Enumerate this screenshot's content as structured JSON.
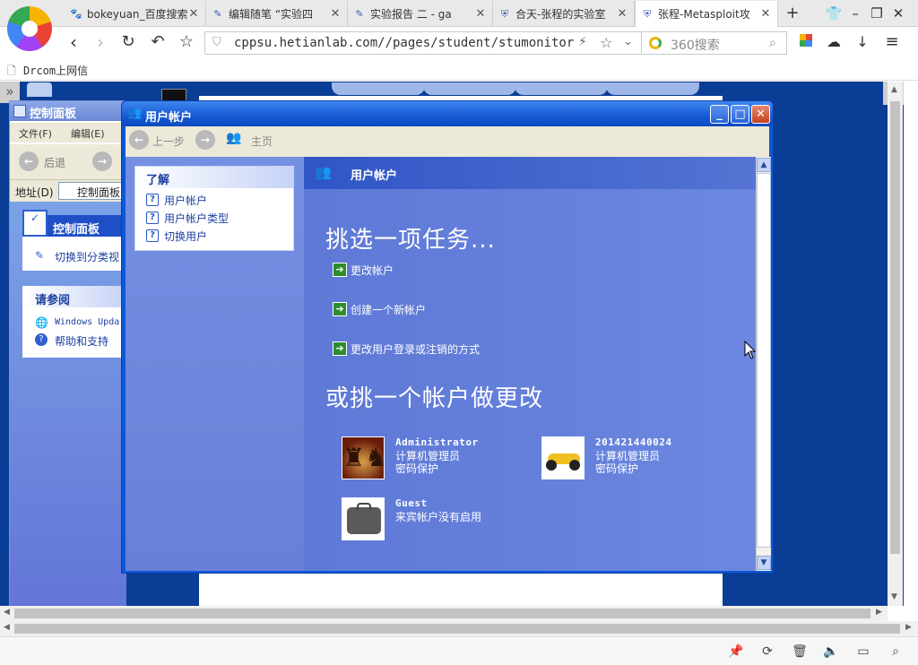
{
  "browser": {
    "tabs": [
      {
        "icon": "paw-icon",
        "label": "bokeyuan_百度搜索"
      },
      {
        "icon": "pen-icon",
        "label": "编辑随笔 “实验四"
      },
      {
        "icon": "pen-icon",
        "label": "实验报告 二 - ga"
      },
      {
        "icon": "shield-icon",
        "label": "合天-张程的实验室"
      },
      {
        "icon": "shield-icon",
        "label": "张程-Metasploit攻"
      }
    ],
    "new_tab": "+",
    "url": "cppsu.hetianlab.com//pages/student/stumonitor.js",
    "search_placeholder": "360搜索",
    "bookmark": "Drcom上网信"
  },
  "bg_window": {
    "title": "控制面板",
    "menu": [
      "文件(F)",
      "编辑(E)"
    ],
    "back": "后退",
    "address_label": "地址(D)",
    "address_value": "控制面板",
    "panel1_title": "控制面板",
    "panel1_item": "切换到分类视",
    "panel2_title": "请参阅",
    "panel2_items": [
      "Windows Upda",
      "帮助和支持"
    ]
  },
  "dialog": {
    "title": "用户帐户",
    "back": "上一步",
    "home": "主页",
    "learn_title": "了解",
    "learn_items": [
      "用户帐户",
      "用户帐户类型",
      "切换用户"
    ],
    "header": "用户帐户",
    "pick_task": "挑选一项任务...",
    "tasks": [
      "更改帐户",
      "创建一个新帐户",
      "更改用户登录或注销的方式"
    ],
    "pick_account": "或挑一个帐户做更改",
    "accounts": [
      {
        "name": "Administrator",
        "line1": "计算机管理员",
        "line2": "密码保护",
        "picture": "chess-icon"
      },
      {
        "name": "201421440024",
        "line1": "计算机管理员",
        "line2": "密码保护",
        "picture": "race-car-icon"
      },
      {
        "name": "Guest",
        "line1": "来宾帐户没有启用",
        "line2": "",
        "picture": "briefcase-icon"
      }
    ]
  }
}
